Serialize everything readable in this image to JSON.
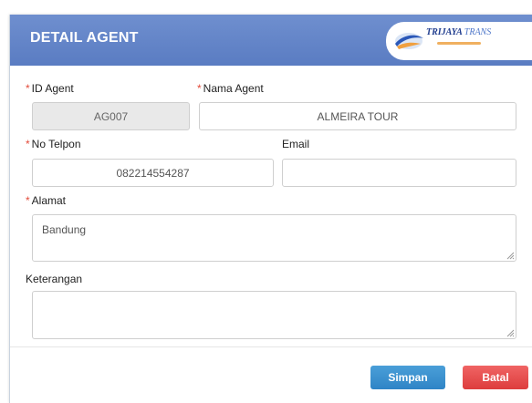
{
  "modal": {
    "title": "DETAIL AGENT",
    "logo_text_main": "TRIJAYA",
    "logo_text_secondary": "TRANS"
  },
  "form": {
    "id_agent": {
      "label": "ID Agent",
      "value": "AG007",
      "required": true
    },
    "nama_agent": {
      "label": "Nama Agent",
      "value": "ALMEIRA TOUR",
      "required": true
    },
    "no_telpon": {
      "label": "No Telpon",
      "value": "082214554287",
      "required": true
    },
    "email": {
      "label": "Email",
      "value": "",
      "required": false
    },
    "alamat": {
      "label": "Alamat",
      "value": "Bandung",
      "required": true
    },
    "keterangan": {
      "label": "Keterangan",
      "value": "",
      "required": false
    },
    "required_marker": "*"
  },
  "buttons": {
    "save_label": "Simpan",
    "cancel_label": "Batal"
  },
  "colors": {
    "header": "#5a7cc2",
    "required_marker": "#e34b3a",
    "save_button": "#2f84c6",
    "cancel_button": "#dd3d3d"
  }
}
